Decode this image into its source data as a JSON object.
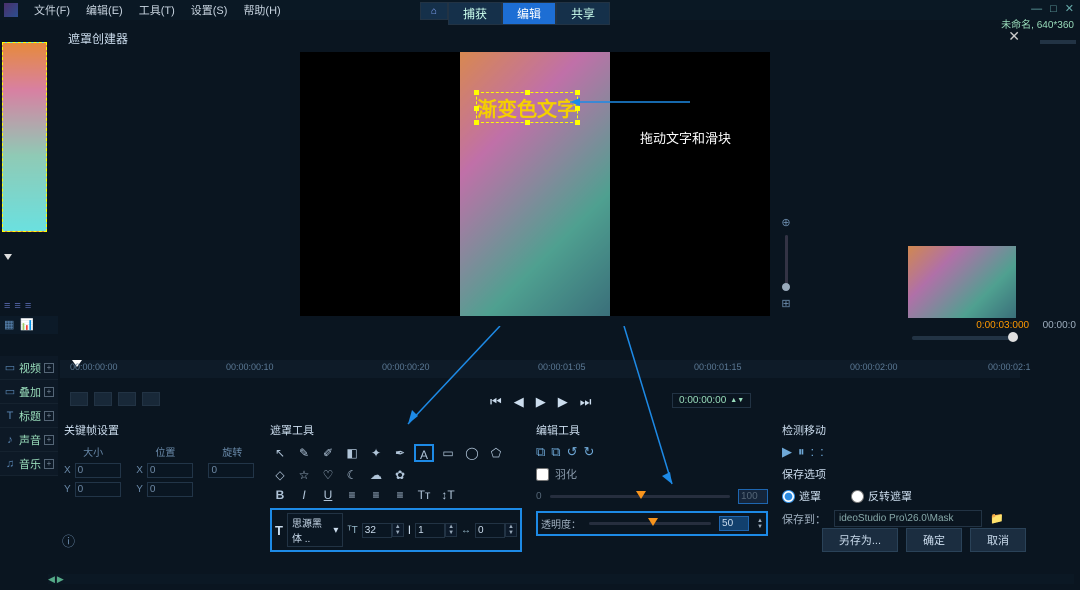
{
  "menu": {
    "file": "文件(F)",
    "edit": "编辑(E)",
    "tool": "工具(T)",
    "settings": "设置(S)",
    "help": "帮助(H)"
  },
  "tabs": {
    "capture": "捕获",
    "edit": "编辑",
    "share": "共享"
  },
  "doc": {
    "name": "未命名",
    "dims": "640*360"
  },
  "mask_creator_title": "遮罩创建器",
  "preview": {
    "text": "渐变色文字",
    "hint": "拖动文字和滑块"
  },
  "timeline_right": {
    "cur": "0:00:03:000",
    "len": "00:00:0"
  },
  "tracks": [
    {
      "icon": "▭",
      "label": "视频"
    },
    {
      "icon": "▭",
      "label": "叠加"
    },
    {
      "icon": "T",
      "label": "标题"
    },
    {
      "icon": "♪",
      "label": "声音"
    },
    {
      "icon": "♫",
      "label": "音乐"
    }
  ],
  "ruler": [
    "00:00:00:00",
    "00:00:00:10",
    "00:00:00:20",
    "00:00:01:05",
    "00:00:01:15",
    "00:00:02:00",
    "00:00:02:1"
  ],
  "timecode": "0:00:00:00",
  "panel_kf": {
    "title": "关键帧设置",
    "size": "大小",
    "pos": "位置",
    "rot": "旋转",
    "xl": "X",
    "yl": "Y",
    "xv": "0",
    "yv": "0",
    "px": "0",
    "py": "0",
    "rv": "0"
  },
  "panel_mask": {
    "title": "遮罩工具",
    "font": "思源黑体 ..",
    "size": "32",
    "track": "1",
    "kern": "0",
    "Tglyph": "T",
    "Iglyph": "I"
  },
  "panel_edit": {
    "title": "编辑工具",
    "feather": "羽化",
    "opacity_label": "透明度：",
    "opacity_val": "50",
    "feather_small": "0",
    "feather_big": "100"
  },
  "panel_save": {
    "detect": "检测移动",
    "opts": "保存选项",
    "mask": "遮罩",
    "inv": "反转遮罩",
    "saveto": "保存到：",
    "path": "ideoStudio Pro\\26.0\\Mask"
  },
  "buttons": {
    "saveas": "另存为...",
    "ok": "确定",
    "cancel": "取消"
  }
}
